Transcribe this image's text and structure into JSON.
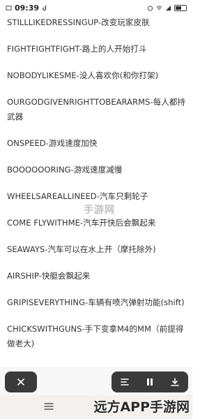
{
  "status_bar": {
    "time": "09:39",
    "battery_level": 0.6
  },
  "cheat_lines": [
    "STILLLIKEDRESSINGUP-改变玩家皮肤",
    "FIGHTFIGHTFIGHT-路上的人开始打斗",
    "NOBODYLIKESME-没人喜欢你(和你打架)",
    "OURGODGIVENRIGHTTOBEARARMS-每人都持武器",
    "ONSPEED-游戏速度加快",
    "BOOOOOORING-游戏速度减慢",
    "WHEELSAREALLINEED-汽车只剩轮子",
    "COME FLYWITHME-汽车开快后会飘起来",
    "SEAWAYS-汽车可以在水上开（摩托除外)",
    "AIRSHIP-快艇会飘起来",
    "GRIPISEVERYTHING-车辆有喷汽弹射功能(shift)",
    "CHICKSWITHGUNS-手下变拿M4的MM（前提得做老大)"
  ],
  "watermark_text": "手游网",
  "toolbar": {
    "close_icon": "close-icon",
    "list_icon": "list-icon",
    "pause_icon": "pause-icon",
    "download_icon": "download-icon"
  },
  "brand": {
    "text": "远方APP手游网"
  },
  "colors": {
    "toolbar_button_bg": "#3a3a3a",
    "text": "#333333",
    "navbar_bg": "#f3f0ee"
  }
}
